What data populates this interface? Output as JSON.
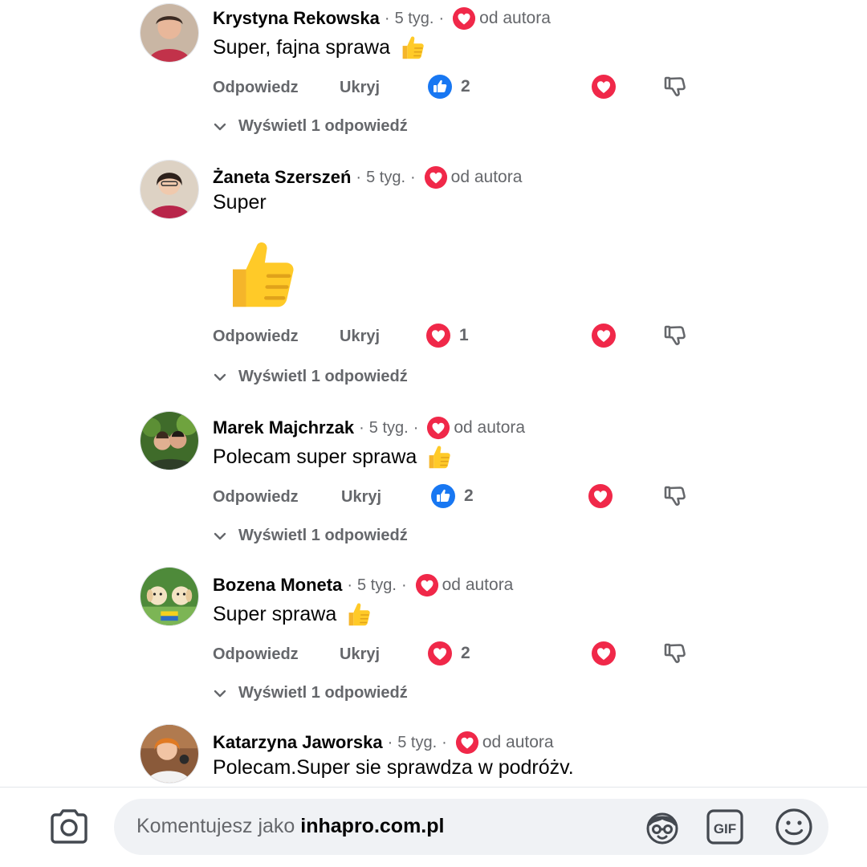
{
  "labels": {
    "reply": "Odpowiedz",
    "hide": "Ukryj",
    "by_author": "od autora",
    "separator": "·"
  },
  "comments": [
    {
      "author": "Krystyna Rekowska",
      "time": "5 tyg.",
      "text": "Super, fajna sprawa",
      "reaction_icon": "like-icon",
      "reaction_count": "2",
      "view_replies": "Wyświetl 1 odpowiedź"
    },
    {
      "author": "Żaneta Szerszeń",
      "time": "5 tyg.",
      "text": "Super",
      "reaction_icon": "heart-icon",
      "reaction_count": "1",
      "view_replies": "Wyświetl 1 odpowiedź"
    },
    {
      "author": "Marek Majchrzak",
      "time": "5 tyg.",
      "text": "Polecam super sprawa",
      "reaction_icon": "like-icon",
      "reaction_count": "2",
      "view_replies": "Wyświetl 1 odpowiedź"
    },
    {
      "author": "Bozena Moneta",
      "time": "5 tyg.",
      "text": "Super sprawa",
      "reaction_icon": "heart-icon",
      "reaction_count": "2",
      "view_replies": "Wyświetl 1 odpowiedź"
    },
    {
      "author": "Katarzyna Jaworska",
      "time": "5 tyg.",
      "text": "Polecam.Super sie sprawdza w podróżv."
    }
  ],
  "composer": {
    "placeholder_prefix": "Komentujesz jako",
    "placeholder_account": "inhapro.com.pl",
    "icons": [
      "camera-icon",
      "avatar-sticker-icon",
      "gif-icon",
      "smiley-icon"
    ]
  },
  "colors": {
    "heart_red": "#f02849",
    "like_blue": "#1877f2",
    "secondary_text": "#65676b",
    "composer_bg": "#f0f2f5"
  }
}
